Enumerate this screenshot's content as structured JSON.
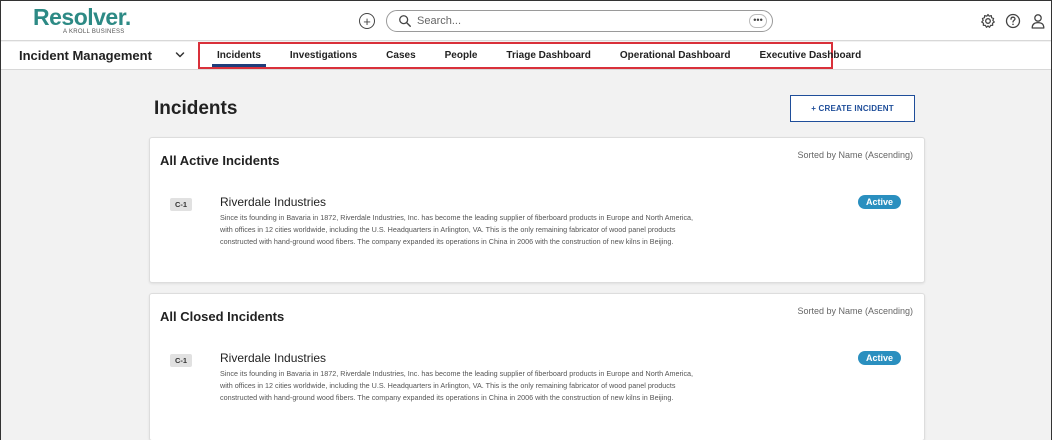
{
  "brand": {
    "logo_text": "Resolver.",
    "logo_subtext": "A KROLL BUSINESS",
    "accent_color": "#2d8a85",
    "primary_color": "#1f4e9a"
  },
  "topbar": {
    "add_icon": "plus-circle-icon",
    "search": {
      "placeholder": "Search...",
      "value": ""
    },
    "search_more_label": "•••",
    "settings_icon": "gear-icon",
    "help_icon": "question-circle-icon",
    "user_icon": "user-icon"
  },
  "navbar": {
    "module_label": "Incident Management",
    "tabs": [
      {
        "label": "Incidents",
        "active": true
      },
      {
        "label": "Investigations"
      },
      {
        "label": "Cases"
      },
      {
        "label": "People"
      },
      {
        "label": "Triage Dashboard"
      },
      {
        "label": "Operational Dashboard"
      },
      {
        "label": "Executive Dashboard"
      }
    ]
  },
  "page": {
    "title": "Incidents",
    "create_button": "+ CREATE INCIDENT"
  },
  "sections": [
    {
      "title": "All Active Incidents",
      "sort_label": "Sorted by Name (Ascending)",
      "items": [
        {
          "id": "C-1",
          "name": "Riverdale Industries",
          "description_lines": [
            "Since its founding in Bavaria in 1872, Riverdale Industries, Inc. has become the leading supplier of fiberboard products in Europe and North America,",
            "with offices in 12 cities worldwide, including the U.S. Headquarters in Arlington, VA. This is the only remaining fabricator of wood panel products",
            "constructed with hand-ground wood fibers. The company expanded its operations in China in 2006 with the construction of new kilns in Beijing."
          ],
          "status": "Active"
        }
      ]
    },
    {
      "title": "All Closed Incidents",
      "sort_label": "Sorted by Name (Ascending)",
      "items": [
        {
          "id": "C-1",
          "name": "Riverdale Industries",
          "description_lines": [
            "Since its founding in Bavaria in 1872, Riverdale Industries, Inc. has become the leading supplier of fiberboard products in Europe and North America,",
            "with offices in 12 cities worldwide, including the U.S. Headquarters in Arlington, VA. This is the only remaining fabricator of wood panel products",
            "constructed with hand-ground wood fibers. The company expanded its operations in China in 2006 with the construction of new kilns in Beijing."
          ],
          "status": "Active"
        }
      ]
    }
  ]
}
